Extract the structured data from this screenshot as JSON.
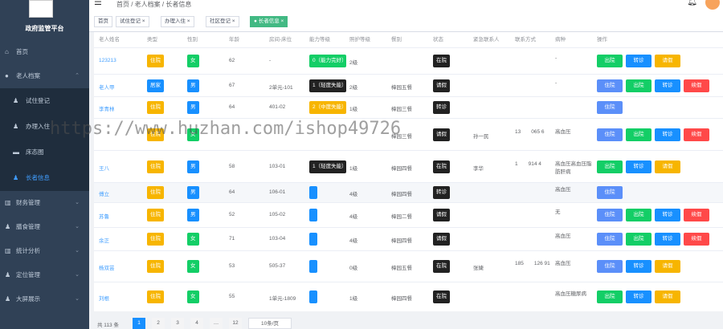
{
  "app": {
    "title": "政府监管平台"
  },
  "sidebar": {
    "items": [
      {
        "label": "首页",
        "icon": "home-icon",
        "arrow": ""
      },
      {
        "label": "老人档案",
        "icon": "user-icon",
        "arrow": "^"
      }
    ],
    "sub": [
      {
        "label": "试住登记",
        "icon": "user-icon"
      },
      {
        "label": "办理入住",
        "icon": "user-icon"
      },
      {
        "label": "床态图",
        "icon": "bed-icon"
      },
      {
        "label": "长者信息",
        "icon": "users-icon"
      }
    ],
    "more": [
      {
        "label": "财务管理",
        "icon": "chart-icon"
      },
      {
        "label": "膳食管理",
        "icon": "user-icon"
      },
      {
        "label": "统计分析",
        "icon": "chart-icon"
      },
      {
        "label": "定位管理",
        "icon": "user-icon"
      },
      {
        "label": "大屏展示",
        "icon": "user-icon"
      }
    ]
  },
  "header": {
    "breadcrumb": "首页 / 老人档案 / 长者信息"
  },
  "tabs": [
    {
      "label": "首页"
    },
    {
      "label": "试住登记 ×"
    },
    {
      "label": "办理入住 ×"
    },
    {
      "label": "社区登记 ×"
    },
    {
      "label": "● 长者信息 ×"
    }
  ],
  "table": {
    "headers": [
      "老人姓名",
      "类型",
      "性别",
      "年龄",
      "房间-床位",
      "能力等级",
      "照护等级",
      "餐别",
      "状态",
      "紧急联系人",
      "联系方式",
      "病种",
      "操作"
    ],
    "rows": [
      {
        "name": "123213",
        "type": "住院",
        "sex": "女",
        "age": "62",
        "bed": "-",
        "ability": "0（能力完好）",
        "care": "2级",
        "meal": "",
        "state": "在院",
        "contact": "",
        "phone": "",
        "disease": "-",
        "ops": [
          "出院",
          "转诊",
          "请假"
        ]
      },
      {
        "name": "老人甲",
        "type": "居家",
        "sex": "男",
        "age": "67",
        "bed": "2单元-101",
        "ability": "1（轻度失能）",
        "care": "2级",
        "meal": "樟园五餐",
        "state": "请假",
        "contact": "",
        "phone": "",
        "disease": "-",
        "ops": [
          "住院",
          "出院",
          "转诊",
          "续假"
        ]
      },
      {
        "name": "李青林",
        "type": "住院",
        "sex": "男",
        "age": "64",
        "bed": "401-02",
        "ability": "2（中度失能）",
        "care": "1级",
        "meal": "樟园三餐",
        "state": "转诊",
        "contact": "",
        "phone": "",
        "disease": "",
        "ops": [
          "住院"
        ]
      },
      {
        "name": "",
        "type": "住院",
        "sex": "女",
        "age": "",
        "bed": "",
        "ability": "",
        "care": "",
        "meal": "樟园三餐",
        "state": "请假",
        "contact": "孙一民",
        "phone": "13　　065 6",
        "disease": "高血压",
        "ops": [
          "住院",
          "出院",
          "转诊",
          "续假"
        ]
      },
      {
        "name": "王八",
        "type": "住院",
        "sex": "男",
        "age": "58",
        "bed": "103-01",
        "ability": "1（轻度失能）",
        "care": "1级",
        "meal": "樟园四餐",
        "state": "在院",
        "contact": "李华",
        "phone": "1　　914 4",
        "disease": "高血压高血压脂肪肝病",
        "ops": [
          "出院",
          "转诊",
          "请假"
        ]
      },
      {
        "name": "傅立",
        "type": "住院",
        "sex": "男",
        "age": "64",
        "bed": "106-01",
        "ability": "",
        "care": "4级",
        "meal": "樟园四餐",
        "state": "转诊",
        "contact": "",
        "phone": "",
        "disease": "高血压",
        "ops": [
          "住院"
        ]
      },
      {
        "name": "苏鲁",
        "type": "住院",
        "sex": "男",
        "age": "52",
        "bed": "105-02",
        "ability": "",
        "care": "4级",
        "meal": "樟园二餐",
        "state": "请假",
        "contact": "",
        "phone": "",
        "disease": "无",
        "ops": [
          "住院",
          "出院",
          "转诊",
          "续假"
        ]
      },
      {
        "name": "余正",
        "type": "住院",
        "sex": "女",
        "age": "71",
        "bed": "103-04",
        "ability": "",
        "care": "4级",
        "meal": "樟园四餐",
        "state": "请假",
        "contact": "",
        "phone": "",
        "disease": "高血压",
        "ops": [
          "住院",
          "出院",
          "转诊",
          "续假"
        ]
      },
      {
        "name": "杨双芸",
        "type": "住院",
        "sex": "女",
        "age": "53",
        "bed": "505-37",
        "ability": "",
        "care": "0级",
        "meal": "樟园五餐",
        "state": "在院",
        "contact": "张婕",
        "phone": "185　　126 91",
        "disease": "高血压",
        "ops": [
          "住院",
          "转诊",
          "请假"
        ]
      },
      {
        "name": "刘根",
        "type": "住院",
        "sex": "女",
        "age": "55",
        "bed": "1单元-1809",
        "ability": "",
        "care": "1级",
        "meal": "樟园四餐",
        "state": "在院",
        "contact": "",
        "phone": "",
        "disease": "高血压糖尿病",
        "ops": [
          "出院",
          "转诊",
          "请假"
        ]
      }
    ]
  },
  "pagination": {
    "total": "共 113 条",
    "pages": [
      "1",
      "2",
      "3",
      "4",
      "…",
      "12"
    ],
    "size": "10条/页"
  },
  "watermark": "https://www.huzhan.com/ishop49726",
  "colors": {
    "primary": "#1890ff",
    "success": "#13ce66",
    "warning": "#f7b500",
    "danger": "#ff4949",
    "sidebar": "#304156"
  }
}
